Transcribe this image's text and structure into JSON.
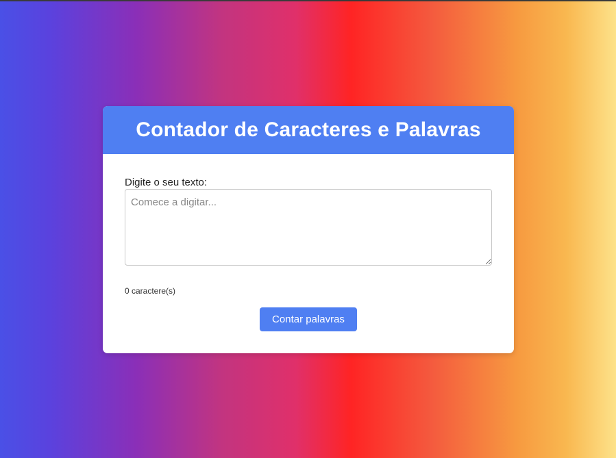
{
  "app": {
    "title": "Contador de Caracteres e Palavras"
  },
  "form": {
    "label": "Digite o seu texto:",
    "textarea_value": "",
    "textarea_placeholder": "Comece a digitar...",
    "char_count_text": "0 caractere(s)",
    "button_label": "Contar palavras"
  },
  "colors": {
    "accent": "#4f7ff2",
    "card_background": "#ffffff",
    "background_gradient": [
      "#4a50e6",
      "#8a2fb8",
      "#e0306a",
      "#ff2424",
      "#f79a40",
      "#fde28a"
    ]
  }
}
